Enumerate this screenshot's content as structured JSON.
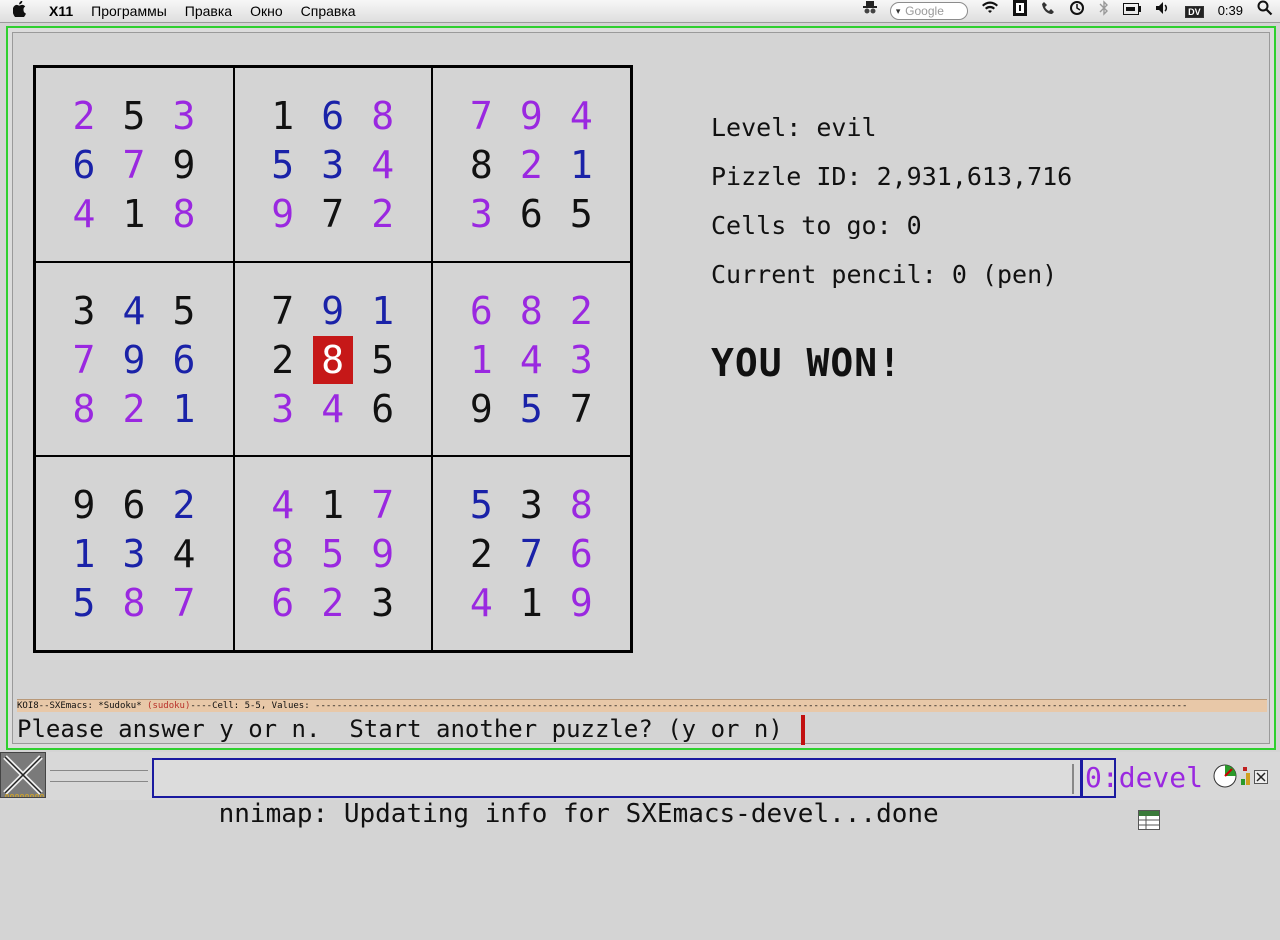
{
  "menubar": {
    "app": "X11",
    "items": [
      "Программы",
      "Правка",
      "Окно",
      "Справка"
    ],
    "search_placeholder": "Google",
    "clock": "0:39",
    "dv_label": "DV"
  },
  "sudoku": {
    "boxes": [
      [
        [
          "2",
          "purple"
        ],
        [
          "5",
          "black"
        ],
        [
          "3",
          "purple"
        ],
        [
          "6",
          "blue"
        ],
        [
          "7",
          "purple"
        ],
        [
          "9",
          "black"
        ],
        [
          "4",
          "purple"
        ],
        [
          "1",
          "black"
        ],
        [
          "8",
          "purple"
        ]
      ],
      [
        [
          "1",
          "black"
        ],
        [
          "6",
          "blue"
        ],
        [
          "8",
          "purple"
        ],
        [
          "5",
          "blue"
        ],
        [
          "3",
          "blue"
        ],
        [
          "4",
          "purple"
        ],
        [
          "9",
          "purple"
        ],
        [
          "7",
          "black"
        ],
        [
          "2",
          "purple"
        ]
      ],
      [
        [
          "7",
          "purple"
        ],
        [
          "9",
          "purple"
        ],
        [
          "4",
          "purple"
        ],
        [
          "8",
          "black"
        ],
        [
          "2",
          "purple"
        ],
        [
          "1",
          "blue"
        ],
        [
          "3",
          "purple"
        ],
        [
          "6",
          "black"
        ],
        [
          "5",
          "black"
        ]
      ],
      [
        [
          "3",
          "black"
        ],
        [
          "4",
          "blue"
        ],
        [
          "5",
          "black"
        ],
        [
          "7",
          "purple"
        ],
        [
          "9",
          "blue"
        ],
        [
          "6",
          "blue"
        ],
        [
          "8",
          "purple"
        ],
        [
          "2",
          "purple"
        ],
        [
          "1",
          "blue"
        ]
      ],
      [
        [
          "7",
          "black"
        ],
        [
          "9",
          "blue"
        ],
        [
          "1",
          "blue"
        ],
        [
          "2",
          "black"
        ],
        [
          "8",
          "selected"
        ],
        [
          "5",
          "black"
        ],
        [
          "3",
          "purple"
        ],
        [
          "4",
          "purple"
        ],
        [
          "6",
          "black"
        ]
      ],
      [
        [
          "6",
          "purple"
        ],
        [
          "8",
          "purple"
        ],
        [
          "2",
          "purple"
        ],
        [
          "1",
          "purple"
        ],
        [
          "4",
          "purple"
        ],
        [
          "3",
          "purple"
        ],
        [
          "9",
          "black"
        ],
        [
          "5",
          "blue"
        ],
        [
          "7",
          "black"
        ]
      ],
      [
        [
          "9",
          "black"
        ],
        [
          "6",
          "black"
        ],
        [
          "2",
          "blue"
        ],
        [
          "1",
          "blue"
        ],
        [
          "3",
          "blue"
        ],
        [
          "4",
          "black"
        ],
        [
          "5",
          "blue"
        ],
        [
          "8",
          "purple"
        ],
        [
          "7",
          "purple"
        ]
      ],
      [
        [
          "4",
          "purple"
        ],
        [
          "1",
          "black"
        ],
        [
          "7",
          "purple"
        ],
        [
          "8",
          "purple"
        ],
        [
          "5",
          "purple"
        ],
        [
          "9",
          "purple"
        ],
        [
          "6",
          "purple"
        ],
        [
          "2",
          "purple"
        ],
        [
          "3",
          "black"
        ]
      ],
      [
        [
          "5",
          "blue"
        ],
        [
          "3",
          "black"
        ],
        [
          "8",
          "purple"
        ],
        [
          "2",
          "black"
        ],
        [
          "7",
          "blue"
        ],
        [
          "6",
          "purple"
        ],
        [
          "4",
          "purple"
        ],
        [
          "1",
          "black"
        ],
        [
          "9",
          "purple"
        ]
      ]
    ]
  },
  "info": {
    "level": "Level: evil",
    "puzzle_id": "Pizzle ID: 2,931,613,716",
    "cells_to_go": "Cells to go: 0",
    "current_pencil": "Current pencil: 0 (pen)",
    "result": "YOU WON!"
  },
  "modeline": {
    "prefix": "KOI8--SXEmacs: *Sudoku*  ",
    "mode": "(sudoku)",
    "suffix": "----Cell: 5-5, Values: -----------------------------------------------------------------------------------------------------------------------------------------------------------------"
  },
  "minibuffer": "Please answer y or n.  Start another puzzle? (y or n) ",
  "taskbar": {
    "status": "nnimap: Updating info for SXEmacs-devel...done",
    "desk": "0:devel"
  },
  "colors": {
    "frame_border": "#2fd02f",
    "selected_cell": "#c61818",
    "blue_digit": "#1a22a8",
    "purple_digit": "#9a28e0",
    "statusbar_border": "#1a1aa0"
  }
}
